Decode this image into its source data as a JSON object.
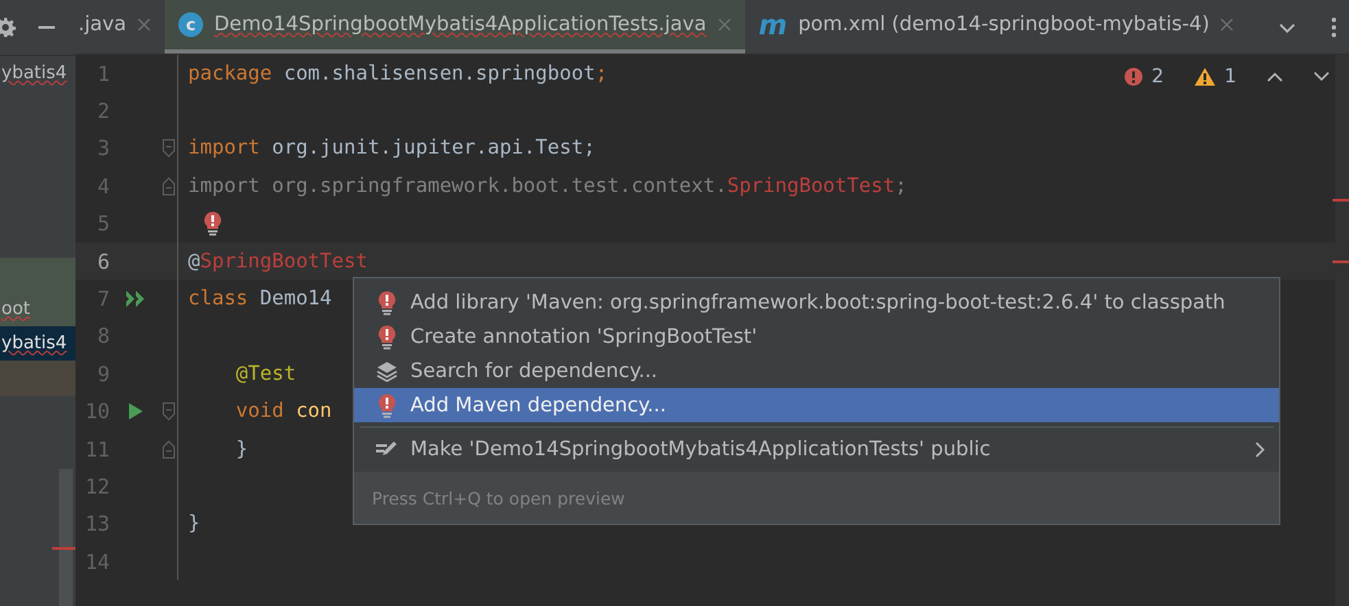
{
  "project_panel": {
    "items": [
      {
        "label": "ybatis4",
        "selected": false,
        "highlighted": false
      },
      {
        "label": "oot",
        "selected": false,
        "highlighted": true
      },
      {
        "label": "ybatis4",
        "selected": true,
        "highlighted": false
      }
    ]
  },
  "tabs": [
    {
      "label": ".java",
      "selected": false,
      "kind": "plain",
      "error": false
    },
    {
      "label": "Demo14SpringbootMybatis4ApplicationTests.java",
      "selected": true,
      "kind": "class",
      "icon_text": "c",
      "error": true
    },
    {
      "label": "pom.xml (demo14-springboot-mybatis-4)",
      "selected": false,
      "kind": "maven",
      "icon_text": "m",
      "error": false
    }
  ],
  "inspections": {
    "errors": "2",
    "warnings": "1"
  },
  "editor": {
    "lines": [
      {
        "number": "1",
        "tokens": [
          {
            "kind": "keyword",
            "text": "package"
          },
          {
            "kind": "plain",
            "text": " com.shalisensen.springboot"
          },
          {
            "kind": "keyword",
            "text": ";"
          }
        ]
      },
      {
        "number": "2"
      },
      {
        "number": "3",
        "fold_start": true,
        "tokens": [
          {
            "kind": "keyword",
            "text": "import"
          },
          {
            "kind": "plain",
            "text": " org.junit.jupiter.api.Test;"
          }
        ]
      },
      {
        "number": "4",
        "fold_end": true,
        "tokens": [
          {
            "kind": "dim",
            "text": "import org.springframework.boot.test.context."
          },
          {
            "kind": "error",
            "text": "SpringBootTest"
          },
          {
            "kind": "dim",
            "text": ";"
          }
        ]
      },
      {
        "number": "5",
        "bulb": true
      },
      {
        "number": "6",
        "current": true,
        "tokens": [
          {
            "kind": "plain",
            "text": "@"
          },
          {
            "kind": "error",
            "text": "SpringBootTest"
          }
        ]
      },
      {
        "number": "7",
        "run_all": true,
        "tokens": [
          {
            "kind": "keyword",
            "text": "class"
          },
          {
            "kind": "plain",
            "text": " Demo14"
          }
        ]
      },
      {
        "number": "8"
      },
      {
        "number": "9",
        "tokens": [
          {
            "kind": "annotation",
            "text": "    @Test"
          }
        ]
      },
      {
        "number": "10",
        "run": true,
        "fold_start": true,
        "tokens": [
          {
            "kind": "keyword",
            "text": "    void"
          },
          {
            "kind": "method",
            "text": " con"
          }
        ]
      },
      {
        "number": "11",
        "fold_end": true,
        "tokens": [
          {
            "kind": "plain",
            "text": "    }"
          }
        ]
      },
      {
        "number": "12"
      },
      {
        "number": "13",
        "tokens": [
          {
            "kind": "plain",
            "text": "}"
          }
        ]
      },
      {
        "number": "14"
      }
    ]
  },
  "popup": {
    "items": [
      {
        "kind": "bulb",
        "label": "Add library 'Maven: org.springframework.boot:spring-boot-test:2.6.4' to classpath",
        "selected": false
      },
      {
        "kind": "bulb",
        "label": "Create annotation 'SpringBootTest'",
        "selected": false
      },
      {
        "kind": "layers",
        "label": "Search for dependency...",
        "selected": false
      },
      {
        "kind": "bulb",
        "label": "Add Maven dependency...",
        "selected": true
      },
      {
        "kind": "edit",
        "label": "Make 'Demo14SpringbootMybatis4ApplicationTests' public",
        "selected": false,
        "submenu": true,
        "separator_before": true
      }
    ],
    "footer": "Press Ctrl+Q to open preview"
  }
}
